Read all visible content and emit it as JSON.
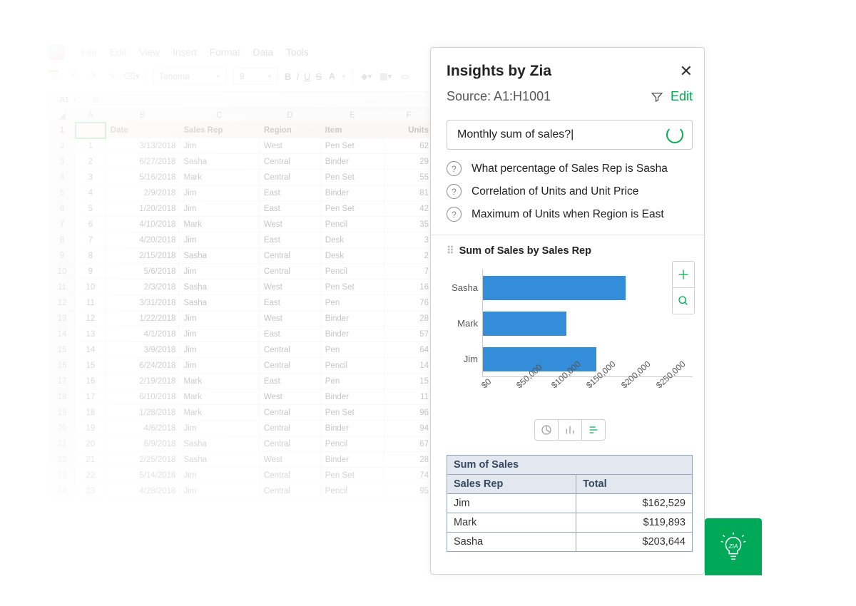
{
  "menu": {
    "file": "File",
    "edit": "Edit",
    "view": "View",
    "insert": "Insert",
    "format": "Format",
    "data": "Data",
    "tools": "Tools"
  },
  "toolbar": {
    "font": "Tahoma",
    "size": "9",
    "namebox": "A1",
    "fx_label": "fx"
  },
  "columns": [
    "A",
    "B",
    "C",
    "D",
    "E",
    "F"
  ],
  "headers": {
    "col_b": "Date",
    "col_c": "Sales Rep",
    "col_d": "Region",
    "col_e": "Item",
    "col_f": "Units"
  },
  "rows": [
    {
      "n": "1",
      "date": "3/13/2018",
      "rep": "Jim",
      "region": "West",
      "item": "Pen Set",
      "units": "62"
    },
    {
      "n": "2",
      "date": "6/27/2018",
      "rep": "Sasha",
      "region": "Central",
      "item": "Binder",
      "units": "29"
    },
    {
      "n": "3",
      "date": "5/16/2018",
      "rep": "Mark",
      "region": "Central",
      "item": "Pen Set",
      "units": "55"
    },
    {
      "n": "4",
      "date": "2/9/2018",
      "rep": "Jim",
      "region": "East",
      "item": "Binder",
      "units": "81"
    },
    {
      "n": "5",
      "date": "1/20/2018",
      "rep": "Jim",
      "region": "East",
      "item": "Pen Set",
      "units": "42"
    },
    {
      "n": "6",
      "date": "4/10/2018",
      "rep": "Mark",
      "region": "West",
      "item": "Pencil",
      "units": "35"
    },
    {
      "n": "7",
      "date": "4/20/2018",
      "rep": "Jim",
      "region": "East",
      "item": "Desk",
      "units": "3"
    },
    {
      "n": "8",
      "date": "2/15/2018",
      "rep": "Sasha",
      "region": "Central",
      "item": "Desk",
      "units": "2"
    },
    {
      "n": "9",
      "date": "5/6/2018",
      "rep": "Jim",
      "region": "Central",
      "item": "Pencil",
      "units": "7"
    },
    {
      "n": "10",
      "date": "2/3/2018",
      "rep": "Sasha",
      "region": "West",
      "item": "Pen Set",
      "units": "16"
    },
    {
      "n": "11",
      "date": "3/31/2018",
      "rep": "Sasha",
      "region": "East",
      "item": "Pen",
      "units": "76"
    },
    {
      "n": "12",
      "date": "1/22/2018",
      "rep": "Jim",
      "region": "West",
      "item": "Binder",
      "units": "28"
    },
    {
      "n": "13",
      "date": "4/1/2018",
      "rep": "Jim",
      "region": "East",
      "item": "Binder",
      "units": "57"
    },
    {
      "n": "14",
      "date": "3/9/2018",
      "rep": "Jim",
      "region": "Central",
      "item": "Pen",
      "units": "64"
    },
    {
      "n": "15",
      "date": "6/24/2018",
      "rep": "Jim",
      "region": "Central",
      "item": "Pencil",
      "units": "14"
    },
    {
      "n": "16",
      "date": "2/19/2018",
      "rep": "Mark",
      "region": "East",
      "item": "Pen",
      "units": "15"
    },
    {
      "n": "17",
      "date": "6/10/2018",
      "rep": "Mark",
      "region": "West",
      "item": "Binder",
      "units": "11"
    },
    {
      "n": "18",
      "date": "1/28/2018",
      "rep": "Mark",
      "region": "Central",
      "item": "Pen Set",
      "units": "96"
    },
    {
      "n": "19",
      "date": "4/6/2018",
      "rep": "Jim",
      "region": "Central",
      "item": "Binder",
      "units": "94"
    },
    {
      "n": "20",
      "date": "6/9/2018",
      "rep": "Sasha",
      "region": "Central",
      "item": "Pencil",
      "units": "67"
    },
    {
      "n": "21",
      "date": "2/25/2018",
      "rep": "Sasha",
      "region": "West",
      "item": "Binder",
      "units": "28"
    },
    {
      "n": "22",
      "date": "5/14/2018",
      "rep": "Jim",
      "region": "Central",
      "item": "Pen Set",
      "units": "74"
    },
    {
      "n": "23",
      "date": "4/28/2018",
      "rep": "Jim",
      "region": "Central",
      "item": "Pencil",
      "units": "95"
    }
  ],
  "zia": {
    "title": "Insights by Zia",
    "source": "Source: A1:H1001",
    "edit": "Edit",
    "query": "Monthly sum of sales?|",
    "suggestions": [
      "What percentage of Sales Rep is Sasha",
      "Correlation of Units and Unit Price",
      "Maximum of Units when Region is East"
    ],
    "chart_title": "Sum of Sales by Sales Rep"
  },
  "chart_data": {
    "type": "bar",
    "orientation": "horizontal",
    "categories": [
      "Sasha",
      "Mark",
      "Jim"
    ],
    "values": [
      203644,
      119893,
      162529
    ],
    "xlabel": "",
    "ylabel": "",
    "xlim": [
      0,
      250000
    ],
    "xticks": [
      "$0",
      "$50,000",
      "$100,000",
      "$150,000",
      "$200,000",
      "$250,000"
    ]
  },
  "summary": {
    "h1": "Sum of Sales",
    "h2a": "Sales Rep",
    "h2b": "Total",
    "rows": [
      {
        "k": "Jim",
        "v": "$162,529"
      },
      {
        "k": "Mark",
        "v": "$119,893"
      },
      {
        "k": "Sasha",
        "v": "$203,644"
      }
    ]
  }
}
